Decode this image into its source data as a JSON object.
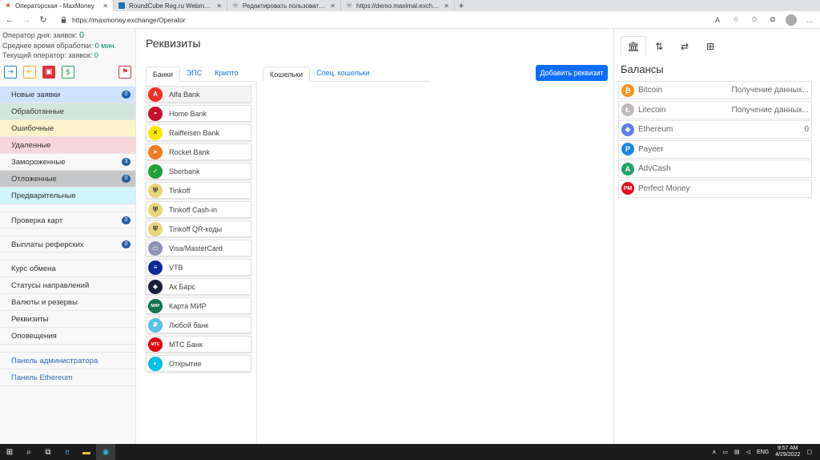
{
  "browser": {
    "tabs": [
      {
        "title": "Операторская - MaxMoney",
        "favicon": "maxmoney-icon",
        "close": "✕"
      },
      {
        "title": "RoundCube Reg.ru Webmail :: В...",
        "favicon": "mail-icon",
        "close": "✕"
      },
      {
        "title": "Редактировать пользователя ‹...",
        "favicon": "wordpress-icon",
        "close": "✕"
      },
      {
        "title": "https://demo.maximal.exchang...",
        "favicon": "wordpress-icon",
        "close": "✕"
      }
    ],
    "new_tab": "+",
    "url": "https://maxmoney.exchange/Operator"
  },
  "sidebar": {
    "stats": [
      {
        "label": "Оператор дня:  заявок: ",
        "value": "0"
      },
      {
        "label": "Среднее время обработки: ",
        "value": "0 мин."
      },
      {
        "label": "Текущий оператор:  заявок: ",
        "value": "0"
      }
    ],
    "menu": [
      {
        "label": "Новые заявки",
        "badge": "0",
        "color": "#cfe2ff"
      },
      {
        "label": "Обработанные",
        "badge": "",
        "color": "#d1e7dd"
      },
      {
        "label": "Ошибочные",
        "badge": "",
        "color": "#fff3cd"
      },
      {
        "label": "Удаленные",
        "badge": "",
        "color": "#f8d7da"
      },
      {
        "label": "Замороженные",
        "badge": "3",
        "color": "#f8f8f8"
      },
      {
        "label": "Отложенные",
        "badge": "0",
        "color": "#c6c7c8"
      },
      {
        "label": "Предварительные",
        "badge": "",
        "color": "#cff4fc"
      }
    ],
    "checks": {
      "label": "Проверка карт",
      "badge": "0"
    },
    "referral": {
      "label": "Выплаты реферских",
      "badge": "0"
    },
    "settings": [
      "Курс обмена",
      "Статусы направлений",
      "Валюты и резервы",
      "Реквизиты",
      "Оповещения"
    ],
    "panels": [
      "Панель администратора",
      "Панель Ethereum"
    ]
  },
  "main": {
    "title": "Реквизиты",
    "add_button": "Добавить реквизит",
    "bank_tabs": [
      "Банки",
      "ЭПС",
      "Крипто"
    ],
    "wallet_tabs": [
      "Кошельки",
      "Спец. кошельки"
    ],
    "banks": [
      {
        "name": "Alfa Bank",
        "icon": "A",
        "color": "#ef3124"
      },
      {
        "name": "Home Bank",
        "icon": "◓",
        "color": "#c8102e"
      },
      {
        "name": "Raiffeisen Bank",
        "icon": "✕",
        "color": "#ffe600"
      },
      {
        "name": "Rocket Bank",
        "icon": "➤",
        "color": "#f47a20"
      },
      {
        "name": "Sberbank",
        "icon": "✓",
        "color": "#21a038"
      },
      {
        "name": "Tinkoff",
        "icon": "⛨",
        "color": "#e8d57a"
      },
      {
        "name": "Tinkoff Cash-in",
        "icon": "⛨",
        "color": "#e8d57a"
      },
      {
        "name": "Tinkoff QR-коды",
        "icon": "⛨",
        "color": "#e8d57a"
      },
      {
        "name": "Visa/MasterCard",
        "icon": "▭",
        "color": "#8c96b4"
      },
      {
        "name": "VTB",
        "icon": "≡",
        "color": "#0a2896"
      },
      {
        "name": "Ак Барс",
        "icon": "◆",
        "color": "#1a1f3a"
      },
      {
        "name": "Карта МИР",
        "icon": "МИР",
        "color": "#0f754e"
      },
      {
        "name": "Любой банк",
        "icon": "₽",
        "color": "#5bc0eb"
      },
      {
        "name": "МТС Банк",
        "icon": "МТС",
        "color": "#e30611"
      },
      {
        "name": "Открытие",
        "icon": "◐",
        "color": "#00bee6"
      }
    ]
  },
  "right": {
    "tabs": [
      {
        "icon": "🏛",
        "name": "bank-building-icon"
      },
      {
        "icon": "⇅",
        "name": "sort-arrows-icon"
      },
      {
        "icon": "⇄",
        "name": "exchange-icon"
      },
      {
        "icon": "⊞",
        "name": "add-box-icon"
      }
    ],
    "title": "Балансы",
    "coins": [
      {
        "name": "Bitcoin",
        "value": "Получение данных...",
        "icon": "₿",
        "color": "#f7931a"
      },
      {
        "name": "Litecoin",
        "value": "Получение данных...",
        "icon": "Ł",
        "color": "#bfbbbb"
      },
      {
        "name": "Ethereum",
        "value": "0",
        "icon": "◆",
        "color": "#627eea"
      },
      {
        "name": "Payeer",
        "value": "",
        "icon": "P",
        "color": "#1e88e5"
      },
      {
        "name": "AdvCash",
        "value": "",
        "icon": "A",
        "color": "#21a366"
      },
      {
        "name": "Perfect Money",
        "value": "",
        "icon": "PM",
        "color": "#e0111c"
      }
    ]
  },
  "taskbar": {
    "lang": "ENG",
    "time": "9:57 AM",
    "date": "4/29/2022"
  }
}
